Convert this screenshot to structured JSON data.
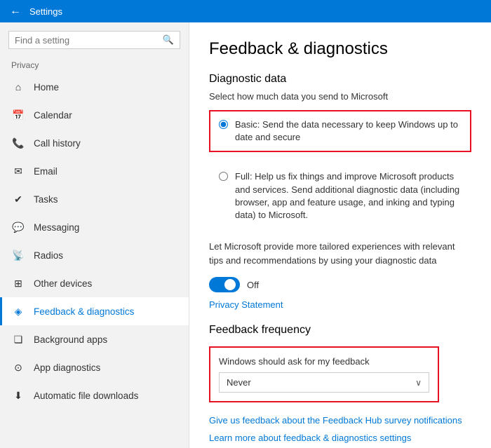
{
  "titlebar": {
    "title": "Settings",
    "back_label": "←"
  },
  "sidebar": {
    "search_placeholder": "Find a setting",
    "section_title": "Privacy",
    "items": [
      {
        "id": "home",
        "label": "Home",
        "icon": "⌂",
        "active": false
      },
      {
        "id": "calendar",
        "label": "Calendar",
        "icon": "📅",
        "active": false
      },
      {
        "id": "call-history",
        "label": "Call history",
        "icon": "📞",
        "active": false
      },
      {
        "id": "email",
        "label": "Email",
        "icon": "✉",
        "active": false
      },
      {
        "id": "tasks",
        "label": "Tasks",
        "icon": "✓",
        "active": false
      },
      {
        "id": "messaging",
        "label": "Messaging",
        "icon": "💬",
        "active": false
      },
      {
        "id": "radios",
        "label": "Radios",
        "icon": "📡",
        "active": false
      },
      {
        "id": "other-devices",
        "label": "Other devices",
        "icon": "⊞",
        "active": false
      },
      {
        "id": "feedback",
        "label": "Feedback & diagnostics",
        "icon": "◈",
        "active": true
      },
      {
        "id": "background-apps",
        "label": "Background apps",
        "icon": "❏",
        "active": false
      },
      {
        "id": "app-diagnostics",
        "label": "App diagnostics",
        "icon": "⊙",
        "active": false
      },
      {
        "id": "automatic-file-downloads",
        "label": "Automatic file downloads",
        "icon": "⬇",
        "active": false
      }
    ]
  },
  "content": {
    "page_title": "Feedback & diagnostics",
    "diagnostic_section": {
      "title": "Diagnostic data",
      "subtitle": "Select how much data you send to Microsoft",
      "options": [
        {
          "id": "basic",
          "label": "Basic: Send the data necessary to keep Windows up to date and secure",
          "selected": true
        },
        {
          "id": "full",
          "label": "Full: Help us fix things and improve Microsoft products and services. Send additional diagnostic data (including browser, app and feature usage, and inking and typing data) to Microsoft.",
          "selected": false
        }
      ],
      "toggle_description": "Let Microsoft provide more tailored experiences with relevant tips and recommendations by using your diagnostic data",
      "toggle_state": "Off",
      "privacy_link": "Privacy Statement"
    },
    "feedback_section": {
      "title": "Feedback frequency",
      "box_label": "Windows should ask for my feedback",
      "dropdown_value": "Never",
      "chevron": "∨"
    },
    "bottom_links": [
      "Give us feedback about the Feedback Hub survey notifications",
      "Learn more about feedback & diagnostics settings"
    ]
  },
  "colors": {
    "accent": "#0078d7",
    "active_nav": "#0078d7",
    "error_border": "#e81123",
    "titlebar_bg": "#0078d7"
  },
  "icons": {
    "search": "🔍",
    "back": "←",
    "radio_checked": "◉",
    "radio_unchecked": "○",
    "chevron_down": "∨"
  }
}
